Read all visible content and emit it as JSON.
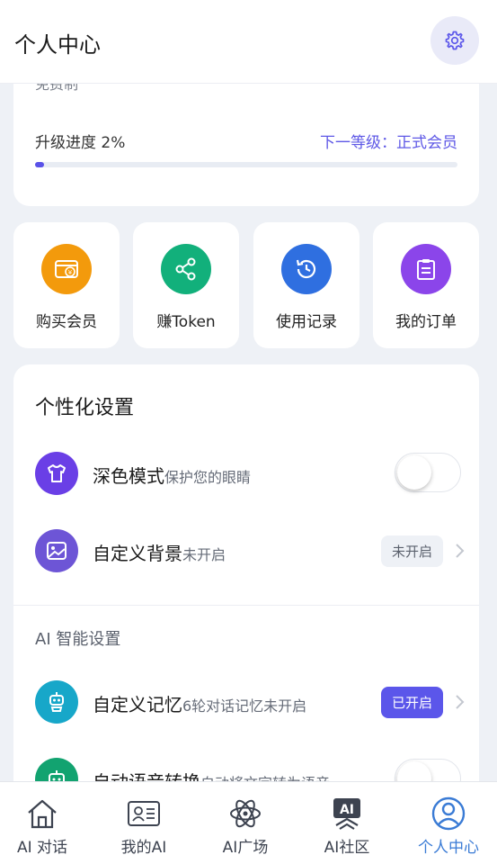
{
  "header": {
    "title": "个人中心",
    "settings_icon": "gear-icon"
  },
  "membership": {
    "cut_text": "免费制",
    "progress_label": "升级进度 2%",
    "progress_percent": 2,
    "next_level": "下一等级：正式会员"
  },
  "quick_actions": [
    {
      "label": "购买会员",
      "icon": "wallet-icon",
      "color": "#f39a0c"
    },
    {
      "label": "赚Token",
      "icon": "share-icon",
      "color": "#12b07b"
    },
    {
      "label": "使用记录",
      "icon": "history-icon",
      "color": "#2f6fe0"
    },
    {
      "label": "我的订单",
      "icon": "clipboard-icon",
      "color": "#8b45ea"
    }
  ],
  "settings": {
    "title": "个性化设置",
    "dark_mode": {
      "title": "深色模式",
      "subtitle": "保护您的眼睛",
      "enabled": false
    },
    "custom_bg": {
      "title": "自定义背景",
      "subtitle": "未开启",
      "status": "未开启"
    },
    "ai_section": "AI 智能设置",
    "memory": {
      "title": "自定义记忆",
      "subtitle": "6轮对话记忆未开启",
      "status": "已开启"
    },
    "voice": {
      "title": "自动语音转换",
      "subtitle": "自动将文字转为语音",
      "enabled": false
    }
  },
  "tabs": [
    {
      "label": "AI 对话",
      "icon": "home-icon",
      "active": false
    },
    {
      "label": "我的AI",
      "icon": "id-card-icon",
      "active": false
    },
    {
      "label": "AI广场",
      "icon": "atom-icon",
      "active": false
    },
    {
      "label": "AI社区",
      "icon": "ai-badge-icon",
      "active": false
    },
    {
      "label": "个人中心",
      "icon": "user-circle-icon",
      "active": true
    }
  ],
  "colors": {
    "accent": "#5b56ea",
    "tab_active": "#3a7bd5"
  }
}
